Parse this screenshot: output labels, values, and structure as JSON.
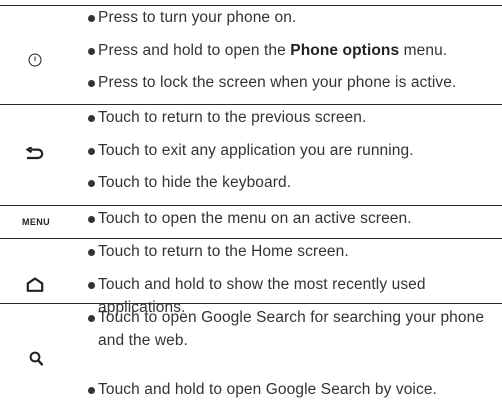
{
  "rows": [
    {
      "icon": "power-icon",
      "bullets": [
        {
          "text": "Press to turn your phone on."
        },
        {
          "pre": "Press and hold to open the ",
          "bold": "Phone options",
          "post": " menu."
        },
        {
          "text": "Press to lock the screen when your phone is active."
        }
      ]
    },
    {
      "icon": "back-icon",
      "bullets": [
        {
          "text": "Touch to return to the previous screen."
        },
        {
          "text": "Touch to exit any application you are running."
        },
        {
          "text": "Touch to hide the keyboard."
        }
      ]
    },
    {
      "icon": "menu-icon",
      "icon_label": "MENU",
      "bullets": [
        {
          "text": "Touch to open the menu on an active screen."
        }
      ]
    },
    {
      "icon": "home-icon",
      "bullets": [
        {
          "text": "Touch to return to the Home screen."
        },
        {
          "text": "Touch and hold to show the most recently used",
          "cont": "applications."
        }
      ]
    },
    {
      "icon": "search-icon",
      "bullets": [
        {
          "text": "Touch to open Google Search for searching your phone",
          "cont": "and the web."
        },
        {
          "text": "Touch and hold to open Google Search by voice."
        }
      ]
    }
  ]
}
